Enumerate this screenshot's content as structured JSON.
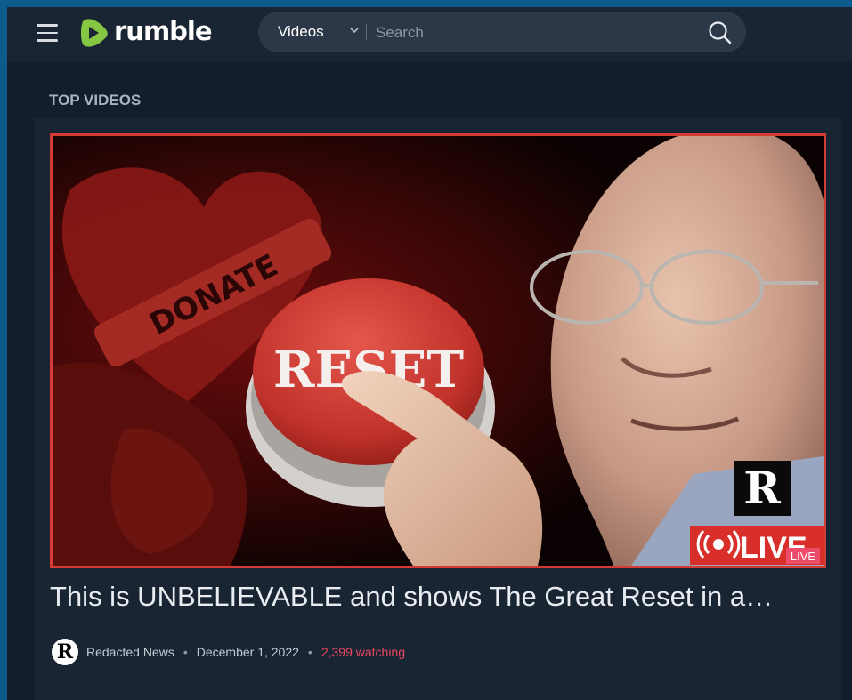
{
  "header": {
    "logo_text": "rumble",
    "search": {
      "category": "Videos",
      "placeholder": "Search"
    }
  },
  "section": {
    "title": "TOP VIDEOS"
  },
  "video": {
    "title": "This is UNBELIEVABLE and shows The Great Reset in a…",
    "thumbnail": {
      "button_text": "RESET",
      "heart_text": "DONATE",
      "badge_letter": "R",
      "live_text": "LIVE",
      "live_small": "LIVE"
    },
    "channel_initial": "R",
    "channel": "Redacted News",
    "separator": "•",
    "date": "December 1, 2022",
    "watching": "2,399 watching"
  },
  "colors": {
    "brand_green": "#85c742",
    "accent_red": "#d53a36",
    "watching_pink": "#e8475f",
    "background": "#131e2c"
  }
}
